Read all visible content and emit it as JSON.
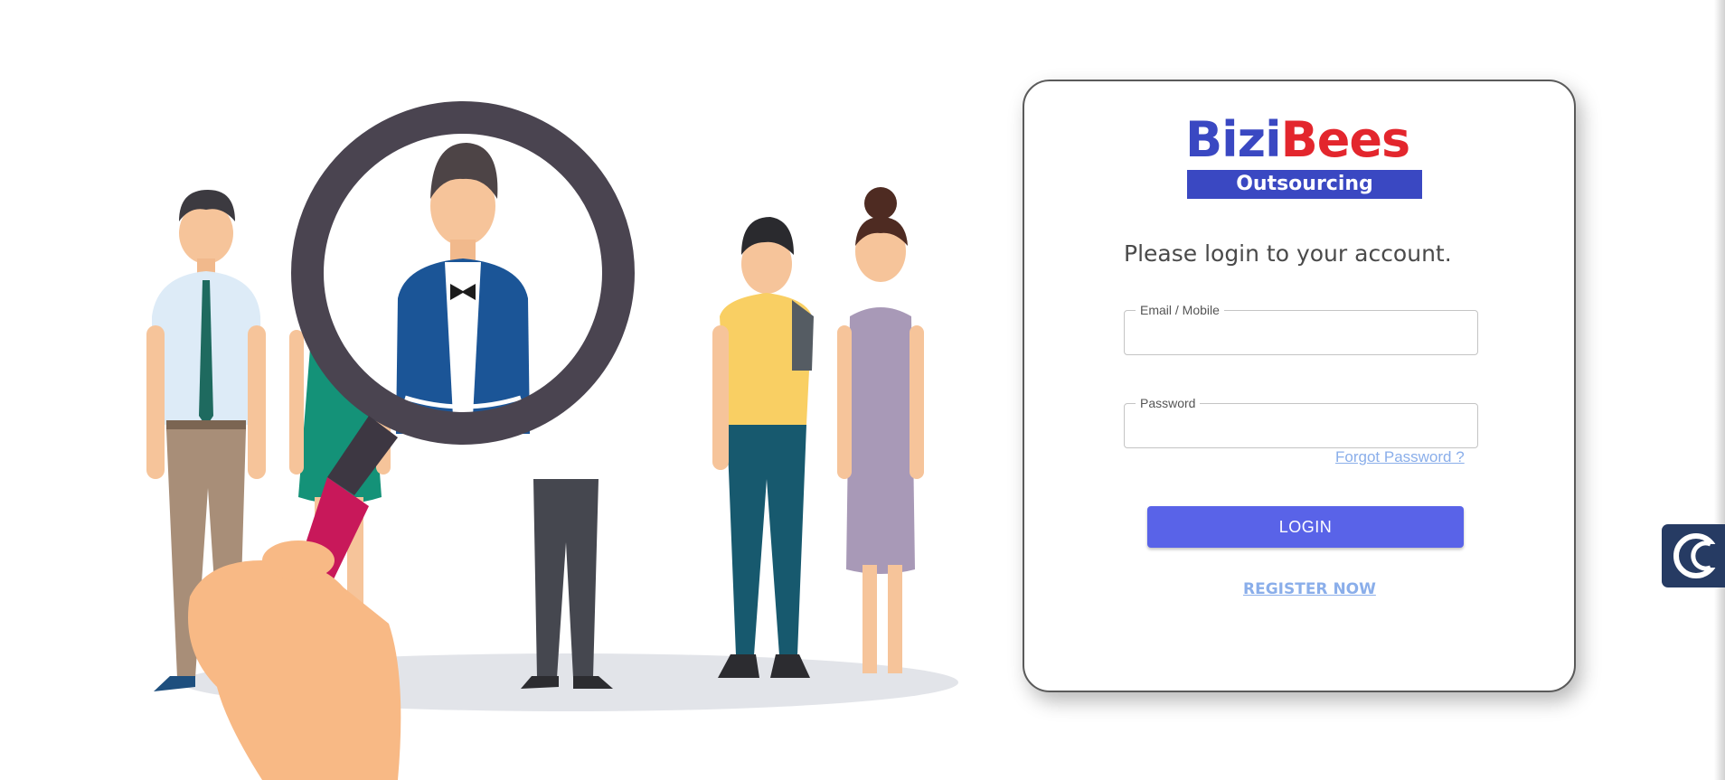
{
  "illustration": {
    "icon": "people-magnifier-illustration"
  },
  "card": {
    "logo": {
      "word_part_a": "Bizi",
      "word_part_b": "Bees",
      "banner": "Outsourcing",
      "colors": {
        "blue": "#3a48c2",
        "red": "#e3262d"
      }
    },
    "heading": "Please login to your account.",
    "email": {
      "label": "Email / Mobile",
      "value": ""
    },
    "password": {
      "label": "Password",
      "value": ""
    },
    "forgot_password": "Forgot Password ?",
    "login_button": "LOGIN",
    "register_link": "REGISTER NOW"
  },
  "side_widget": {
    "icon": "chat-c-icon"
  },
  "colors": {
    "accent": "#5963e8",
    "link": "#8aaeea",
    "widget": "#263b63"
  }
}
